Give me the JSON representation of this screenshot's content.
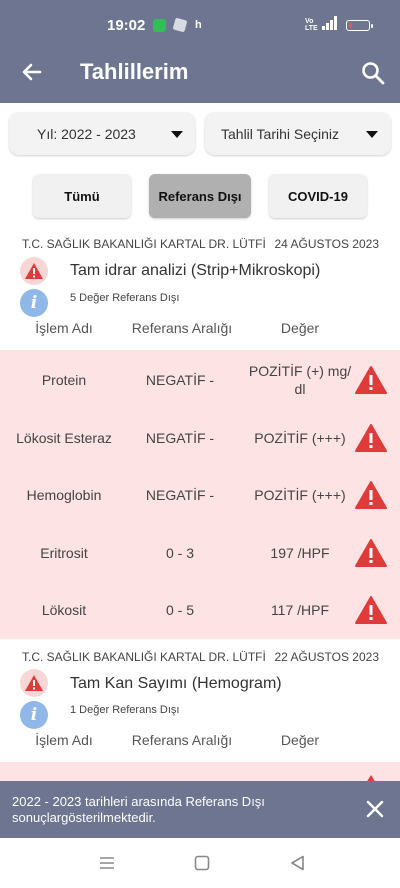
{
  "status_bar": {
    "time": "19:02",
    "h_label": "h",
    "network": "Vo LTE",
    "battery_level": 0.15
  },
  "app_bar": {
    "title": "Tahlillerim"
  },
  "filters": {
    "year_label": "Yıl: 2022 - 2023",
    "date_placeholder": "Tahlil Tarihi Seçiniz",
    "tabs": [
      "Tümü",
      "Referans Dışı",
      "COVID-19"
    ],
    "selected_tab": "Referans Dışı"
  },
  "labs": [
    {
      "institution": "T.C. SAĞLIK BAKANLIĞI KARTAL DR. LÜTFİ",
      "date": "24 AĞUSTOS 2023",
      "name": "Tam idrar analizi (Strip+Mikroskopi)",
      "outside_count": "5 Değer Referans Dışı",
      "columns": [
        "İşlem Adı",
        "Referans Aralığı",
        "Değer"
      ],
      "results": [
        {
          "name": "Protein",
          "range": "NEGATİF -",
          "value": "POZİTİF (+) mg/ dl"
        },
        {
          "name": "Lökosit Esteraz",
          "range": "NEGATİF -",
          "value": "POZİTİF (+++)"
        },
        {
          "name": "Hemoglobin",
          "range": "NEGATİF -",
          "value": "POZİTİF (+++)"
        },
        {
          "name": "Eritrosit",
          "range": "0 - 3",
          "value": "197 /HPF"
        },
        {
          "name": "Lökosit",
          "range": "0 - 5",
          "value": "117 /HPF"
        }
      ]
    },
    {
      "institution": "T.C. SAĞLIK BAKANLIĞI KARTAL DR. LÜTFİ",
      "date": "22 AĞUSTOS 2023",
      "name": "Tam Kan Sayımı (Hemogram)",
      "outside_count": "1 Değer Referans Dışı",
      "columns": [
        "İşlem Adı",
        "Referans Aralığı",
        "Değer"
      ],
      "results": []
    }
  ],
  "snackbar": {
    "message": "2022 - 2023 tarihleri arasında Referans Dışı sonuçlargösterilmektedir."
  },
  "colors": {
    "header": "#6d7590",
    "alert": "#e03b3b",
    "alert_bg": "#fde3e3",
    "info": "#8fb8e8"
  },
  "icons": {
    "back": "arrow-left-icon",
    "search": "search-icon",
    "caret": "caret-down-icon",
    "warning": "warning-triangle-icon",
    "info": "info-icon",
    "close": "close-icon",
    "nav": [
      "menu-icon",
      "home-square-icon",
      "back-triangle-icon"
    ]
  }
}
